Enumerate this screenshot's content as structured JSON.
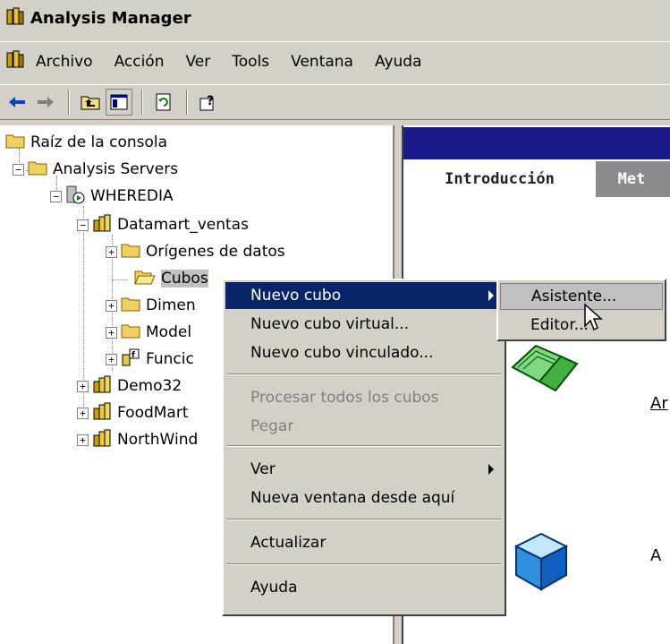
{
  "window": {
    "title": "Analysis Manager"
  },
  "menubar": {
    "items": [
      "Archivo",
      "Acción",
      "Ver",
      "Tools",
      "Ventana",
      "Ayuda"
    ]
  },
  "toolbar": {
    "buttons": [
      "back-icon",
      "forward-icon",
      "up-folder-icon",
      "show-hide-tree-icon",
      "refresh-icon",
      "help-icon"
    ]
  },
  "tree": {
    "root": "Raíz de la consola",
    "analysis_servers": "Analysis Servers",
    "server": "WHEREDIA",
    "database": "Datamart_ventas",
    "data_sources": "Orígenes de datos",
    "cubes": "Cubos",
    "dimensions": "Dimen",
    "models": "Model",
    "functions": "Funcic",
    "demo": "Demo32",
    "foodmart": "FoodMart",
    "northwind": "NorthWind"
  },
  "context_menu": {
    "items": {
      "new_cube": "Nuevo cubo",
      "new_virtual_cube": "Nuevo cubo virtual...",
      "new_linked_cube": "Nuevo cubo vinculado...",
      "process_all": "Procesar todos los cubos",
      "paste": "Pegar",
      "view": "Ver",
      "new_window": "Nueva ventana desde aquí",
      "refresh": "Actualizar",
      "help": "Ayuda"
    }
  },
  "submenu": {
    "wizard": "Asistente...",
    "editor": "Editor..."
  },
  "right_pane": {
    "tab_active": "Introducción",
    "tab_inactive": "Met",
    "text_1": "Ar",
    "text_2": "A"
  },
  "colors": {
    "chrome": "#d4d0c8",
    "highlight": "#0a246a",
    "header": "#1a1a8c"
  }
}
